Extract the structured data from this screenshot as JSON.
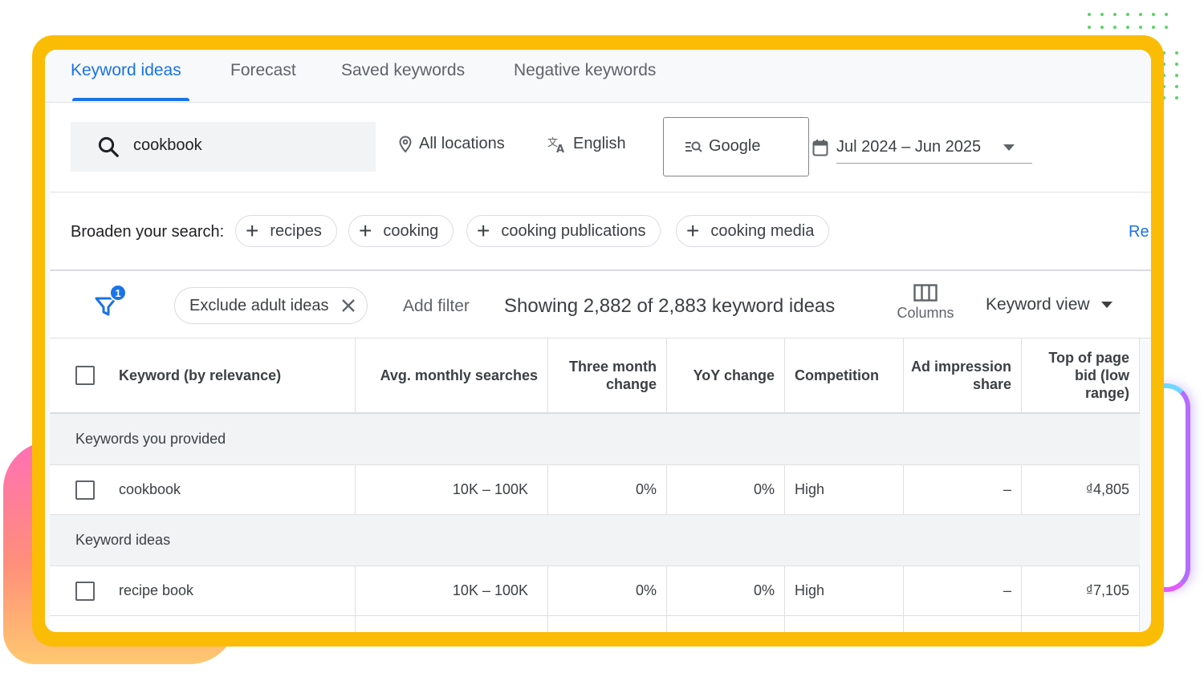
{
  "tabs": [
    {
      "label": "Keyword ideas",
      "active": true
    },
    {
      "label": "Forecast",
      "active": false
    },
    {
      "label": "Saved keywords",
      "active": false
    },
    {
      "label": "Negative keywords",
      "active": false
    }
  ],
  "search": {
    "value": "cookbook",
    "location": "All locations",
    "language": "English",
    "network": "Google",
    "date_range": "Jul 2024 – Jun 2025"
  },
  "broaden": {
    "label": "Broaden your search:",
    "chips": [
      "recipes",
      "cooking",
      "cooking publications",
      "cooking media"
    ],
    "refine_link": "Re"
  },
  "filters": {
    "badge_count": "1",
    "exclude_chip": "Exclude adult ideas",
    "add_filter": "Add filter",
    "showing": "Showing 2,882 of 2,883 keyword ideas",
    "columns_label": "Columns",
    "view_label": "Keyword view"
  },
  "table": {
    "headers": {
      "keyword": "Keyword (by relevance)",
      "avg": "Avg. monthly searches",
      "three_month_1": "Three month",
      "three_month_2": "change",
      "yoy": "YoY change",
      "competition": "Competition",
      "ad_impression_1": "Ad impression",
      "ad_impression_2": "share",
      "top_bid_1": "Top of page",
      "top_bid_2": "bid (low",
      "top_bid_3": "range)"
    },
    "group_provided": "Keywords you provided",
    "group_ideas": "Keyword ideas",
    "rows": [
      {
        "keyword": "cookbook",
        "avg": "10K – 100K",
        "three_month": "0%",
        "yoy": "0%",
        "competition": "High",
        "ad_share": "–",
        "top_bid": "₫4,805"
      },
      {
        "keyword": "recipe book",
        "avg": "10K – 100K",
        "three_month": "0%",
        "yoy": "0%",
        "competition": "High",
        "ad_share": "–",
        "top_bid": "₫7,105"
      }
    ]
  },
  "colors": {
    "accent": "#1a73e8",
    "frame": "#fbbc05"
  }
}
